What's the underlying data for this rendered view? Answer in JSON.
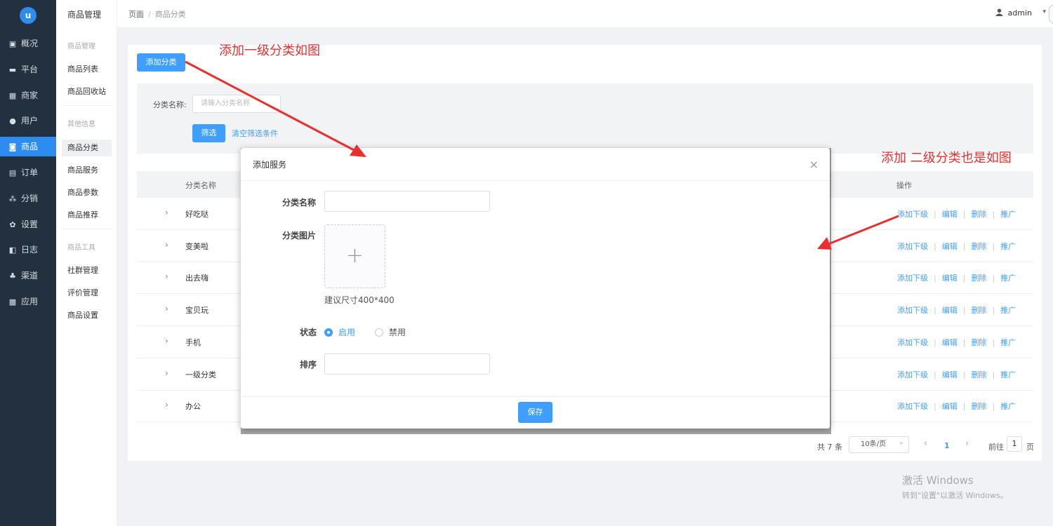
{
  "nav": {
    "logo": "u",
    "items": [
      {
        "label": "概况",
        "icon": "dashboard-icon",
        "glyph": "▣"
      },
      {
        "label": "平台",
        "icon": "monitor-icon",
        "glyph": "▬"
      },
      {
        "label": "商家",
        "icon": "store-icon",
        "glyph": "▦"
      },
      {
        "label": "用户",
        "icon": "user-icon",
        "glyph": "●"
      },
      {
        "label": "商品",
        "icon": "goods-icon",
        "glyph": "◙"
      },
      {
        "label": "订单",
        "icon": "order-icon",
        "glyph": "▤"
      },
      {
        "label": "分销",
        "icon": "hierarchy-icon",
        "glyph": "⁂"
      },
      {
        "label": "设置",
        "icon": "gear-icon",
        "glyph": "✿"
      },
      {
        "label": "日志",
        "icon": "log-icon",
        "glyph": "◧"
      },
      {
        "label": "渠道",
        "icon": "channel-icon",
        "glyph": "♣"
      },
      {
        "label": "应用",
        "icon": "apps-icon",
        "glyph": "▩"
      }
    ],
    "active": "商品"
  },
  "sub": {
    "title": "商品管理",
    "groups": [
      {
        "head": "商品管理",
        "items": [
          "商品列表",
          "商品回收站"
        ]
      },
      {
        "head": "其他信息",
        "items": [
          "商品分类",
          "商品服务",
          "商品参数",
          "商品推荐"
        ]
      },
      {
        "head": "商品工具",
        "items": [
          "社群管理",
          "评价管理",
          "商品设置"
        ]
      }
    ],
    "active": "商品分类"
  },
  "header": {
    "crumb_root": "页面",
    "crumb_sep": "/",
    "crumb_current": "商品分类",
    "user": "admin",
    "caret": "▾"
  },
  "toolbar": {
    "add_label": "添加分类"
  },
  "filter": {
    "label": "分类名称:",
    "placeholder": "请输入分类名称",
    "submit": "筛选",
    "clear": "清空筛选条件"
  },
  "table": {
    "col_name": "分类名称",
    "col_ops": "操作",
    "rows": [
      "好吃哒",
      "变美啦",
      "出去嗨",
      "宝贝玩",
      "手机",
      "一级分类",
      "办公"
    ],
    "ops": [
      "添加下级",
      "编辑",
      "删除",
      "推广"
    ],
    "op_sep": "|",
    "expand": "›"
  },
  "pager": {
    "total": "共 7 条",
    "size": "10条/页",
    "size_caret": "⌄",
    "prev": "‹",
    "page": "1",
    "next": "›",
    "goto_prefix": "前往",
    "goto_value": "1",
    "goto_suffix": "页"
  },
  "modal": {
    "title": "添加服务",
    "close": "×",
    "name_label": "分类名称",
    "image_label": "分类图片",
    "upload_plus": "+",
    "size_hint": "建议尺寸400*400",
    "status_label": "状态",
    "status_on": "启用",
    "status_off": "禁用",
    "sort_label": "排序",
    "save": "保存"
  },
  "annotations": {
    "level1": "添加一级分类如图",
    "level2": "添加 二级分类也是如图"
  },
  "watermark": {
    "line1": "激活 Windows",
    "line2": "转到\"设置\"以激活 Windows。"
  },
  "colors": {
    "primary": "#409eff",
    "nav_bg": "#23303f",
    "annotation": "#e83030"
  }
}
